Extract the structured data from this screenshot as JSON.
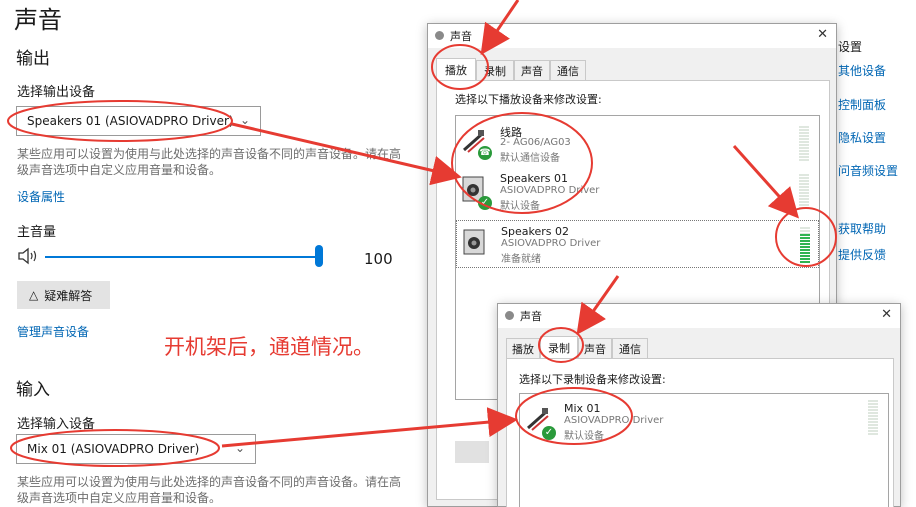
{
  "settings": {
    "title": "声音",
    "output": {
      "heading": "输出",
      "select_label": "选择输出设备",
      "selected_device": "Speakers 01 (ASIOVADPRO Driver)",
      "description_line1": "某些应用可以设置为使用与此处选择的声音设备不同的声音设备。请在高",
      "description_line2": "级声音选项中自定义应用音量和设备。",
      "device_properties_link": "设备属性",
      "master_volume_label": "主音量",
      "volume_value": "100",
      "volume_level": 1.0,
      "troubleshoot_button": "疑难解答",
      "manage_devices_link": "管理声音设备"
    },
    "input": {
      "heading": "输入",
      "select_label": "选择输入设备",
      "selected_device": "Mix 01 (ASIOVADPRO Driver)",
      "description_line1": "某些应用可以设置为使用与此处选择的声音设备不同的声音设备。请在高",
      "description_line2": "级声音选项中自定义应用音量和设备。"
    },
    "side_links": [
      "设置",
      "其他设备",
      "控制面板",
      "隐私设置",
      "问音频设置",
      "获取帮助",
      "提供反馈"
    ]
  },
  "annotation_text": "开机架后，通道情况。",
  "playback_dialog": {
    "title": "声音",
    "close_glyph": "✕",
    "tabs": [
      "播放",
      "录制",
      "声音",
      "通信"
    ],
    "active_tab": 0,
    "instruction": "选择以下播放设备来修改设置:",
    "devices": [
      {
        "name": "线路",
        "sub": "2- AG06/AG03",
        "status": "默认通信设备",
        "badge": "phone",
        "level": 0
      },
      {
        "name": "Speakers 01",
        "sub": "ASIOVADPRO Driver",
        "status": "默认设备",
        "badge": "check",
        "level": 0
      },
      {
        "name": "Speakers 02",
        "sub": "ASIOVADPRO Driver",
        "status": "准备就绪",
        "badge": "none",
        "level": 0.8
      }
    ]
  },
  "recording_dialog": {
    "title": "声音",
    "close_glyph": "✕",
    "tabs": [
      "播放",
      "录制",
      "声音",
      "通信"
    ],
    "active_tab": 1,
    "instruction": "选择以下录制设备来修改设置:",
    "devices": [
      {
        "name": "Mix 01",
        "sub": "ASIOVADPRO Driver",
        "status": "默认设备",
        "badge": "check",
        "level": 0
      }
    ]
  },
  "icons": {
    "speaker": "speaker-icon",
    "warning": "warning-triangle-icon",
    "chevron": "chevron-down-icon",
    "check": "default-check-icon"
  },
  "colors": {
    "accent": "#0078d7",
    "link": "#0066b4",
    "annotation_red": "#e63b32",
    "meter_green": "#2fb350"
  }
}
